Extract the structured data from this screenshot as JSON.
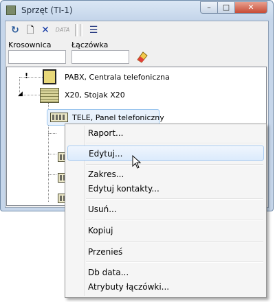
{
  "window": {
    "title": "Sprzęt (TI-1)",
    "minimize": "–",
    "maximize": "□",
    "close": "✕"
  },
  "toolbar": {
    "refresh": "↻",
    "new": "🗋",
    "delete": "✕",
    "data": "DATA",
    "view": "☰"
  },
  "filters": {
    "krosownica_label": "Krosownica",
    "krosownica_value": "",
    "laczowka_label": "Łączówka",
    "laczowka_value": ""
  },
  "tree": {
    "pabx": "PABX, Centrala telefoniczna",
    "rack": "X20, Stojak X20",
    "panel": "TELE, Panel telefoniczny",
    "pabx_marker": "!"
  },
  "menu": {
    "items": [
      "Raport...",
      "Edytuj...",
      "Zakres...",
      "Edytuj kontakty...",
      "Usuń...",
      "Kopiuj",
      "Przenieś",
      "Db data...",
      "Atrybuty łączówki..."
    ]
  },
  "icons": {
    "title": "equipment-icon",
    "eraser": "eraser-icon"
  },
  "colors": {
    "accent": "#99c4ee",
    "close": "#c74a35"
  }
}
